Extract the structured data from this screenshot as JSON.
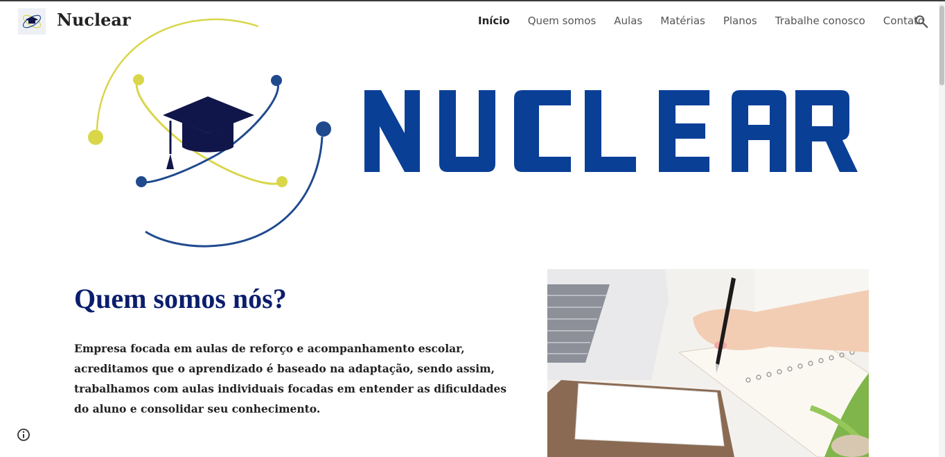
{
  "header": {
    "site_name": "Nuclear",
    "logo_icon": "graduation-cap-atom-logo",
    "nav": [
      {
        "label": "Início",
        "active": true
      },
      {
        "label": "Quem somos",
        "active": false
      },
      {
        "label": "Aulas",
        "active": false
      },
      {
        "label": "Matérias",
        "active": false
      },
      {
        "label": "Planos",
        "active": false
      },
      {
        "label": "Trabalhe conosco",
        "active": false
      },
      {
        "label": "Contato",
        "active": false
      }
    ],
    "search_icon": "search-icon"
  },
  "hero": {
    "wordmark": "NUCLEAR",
    "colors": {
      "blue": "#0a3f96",
      "navy": "#10154a",
      "yellow": "#d9d64a",
      "orbit_blue": "#1f4a8e"
    }
  },
  "about": {
    "title": "Quem somos nós?",
    "body": "Empresa focada em aulas de reforço e acompanhamento escolar, acreditamos que o aprendizado é baseado na adaptação, sendo assim, trabalhamos com aulas individuais focadas em entender as dificuldades do aluno e consolidar seu conhecimento.",
    "title_color": "#0b1e6d"
  },
  "footer": {
    "info_icon": "info-icon"
  }
}
